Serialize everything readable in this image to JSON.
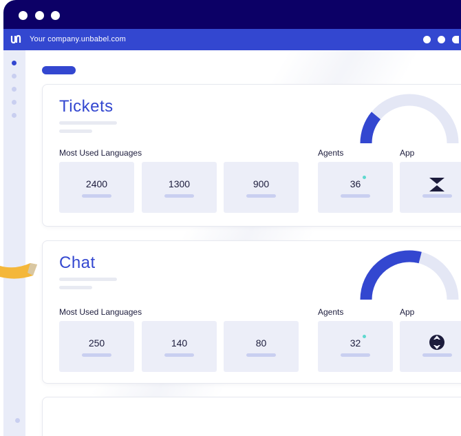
{
  "browser": {
    "url": "Your company.unbabel.com"
  },
  "sections": [
    {
      "title": "Tickets",
      "languages_label": "Most Used Languages",
      "language_counts": [
        "2400",
        "1300",
        "900"
      ],
      "agents_label": "Agents",
      "agents_count": "36",
      "app_label": "App",
      "gauge_fraction": 0.22
    },
    {
      "title": "Chat",
      "languages_label": "Most Used Languages",
      "language_counts": [
        "250",
        "140",
        "80"
      ],
      "agents_label": "Agents",
      "agents_count": "32",
      "app_label": "App",
      "gauge_fraction": 0.58
    }
  ],
  "colors": {
    "brand": "#3347d0",
    "titlebar": "#0c0066",
    "tile": "#eceef8",
    "accent_teal": "#5fd8cf",
    "ribbon": "#f4b73a"
  },
  "icons": {
    "app1": "zendesk-icon",
    "app2": "chat-app-icon"
  }
}
